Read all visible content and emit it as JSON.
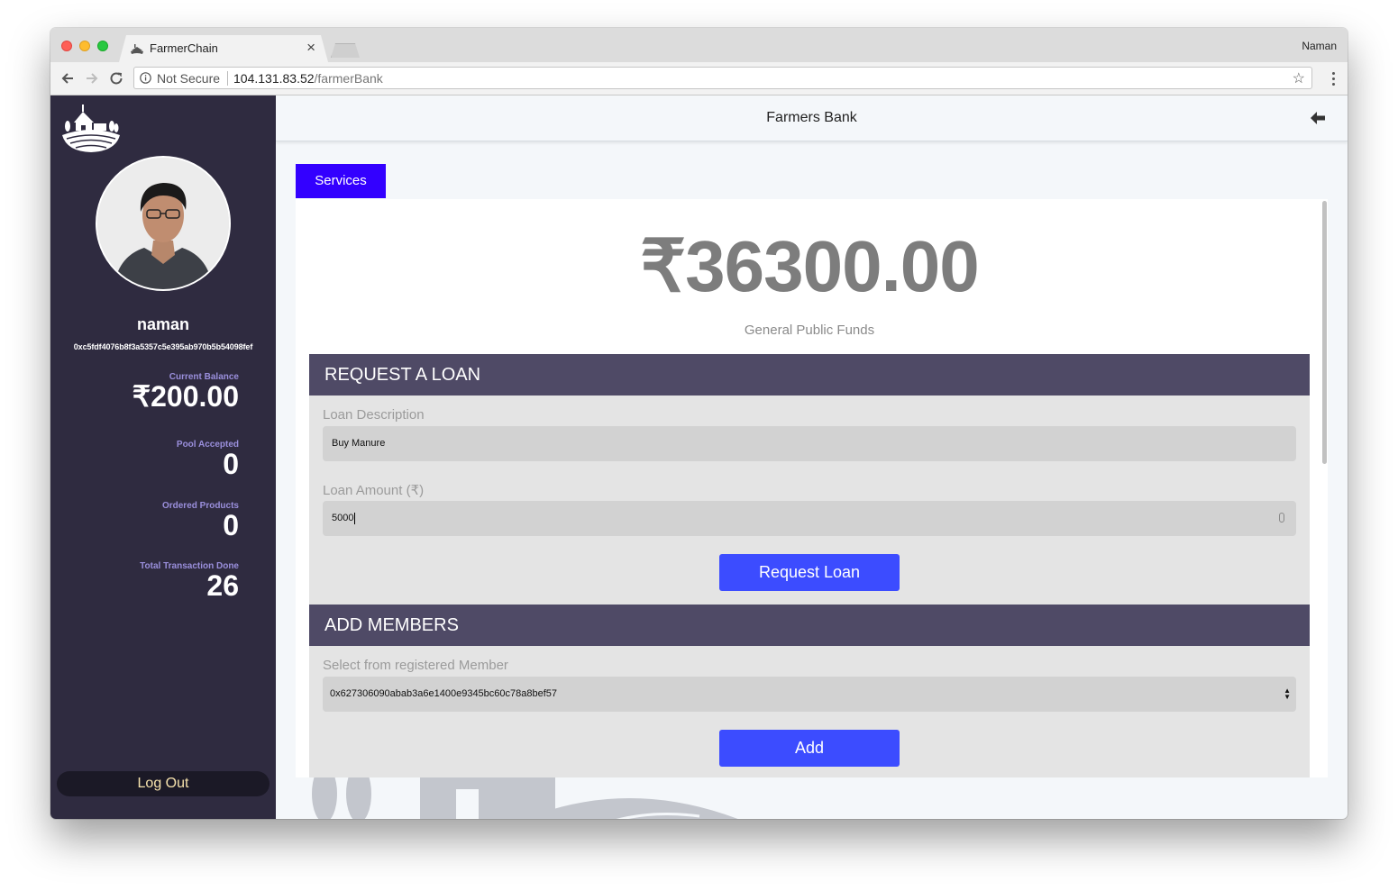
{
  "browser": {
    "tab_title": "FarmerChain",
    "tab_close": "×",
    "profile_name": "Naman",
    "security_label": "Not Secure",
    "url_host": "104.131.83.52",
    "url_path": "/farmerBank",
    "bookmark_star": "☆"
  },
  "sidebar": {
    "user_name": "naman",
    "user_address": "0xc5fdf4076b8f3a5357c5e395ab970b5b54098fef",
    "stats": [
      {
        "label": "Current Balance",
        "value": "₹200.00"
      },
      {
        "label": "Pool Accepted",
        "value": "0"
      },
      {
        "label": "Ordered Products",
        "value": "0"
      },
      {
        "label": "Total Transaction Done",
        "value": "26"
      }
    ],
    "logout_label": "Log Out"
  },
  "header": {
    "title": "Farmers Bank"
  },
  "main": {
    "tab_label": "Services",
    "funds_amount": "₹36300.00",
    "funds_label": "General Public Funds",
    "loan_section": {
      "heading": "REQUEST A LOAN",
      "description_label": "Loan Description",
      "description_value": "Buy Manure",
      "amount_label": "Loan Amount (₹)",
      "amount_value": "5000",
      "submit_label": "Request Loan"
    },
    "members_section": {
      "heading": "ADD MEMBERS",
      "select_label": "Select from registered Member",
      "selected_member": "0x627306090abab3a6e1400e9345bc60c78a8bef57",
      "add_label": "Add"
    }
  },
  "colors": {
    "sidebar_bg": "#2f2b40",
    "section_header": "#4f4a66",
    "accent_tab": "#3300ff",
    "button": "#3c4cff",
    "stat_label": "#9a8fdc",
    "logout_text": "#f7e3ad"
  }
}
